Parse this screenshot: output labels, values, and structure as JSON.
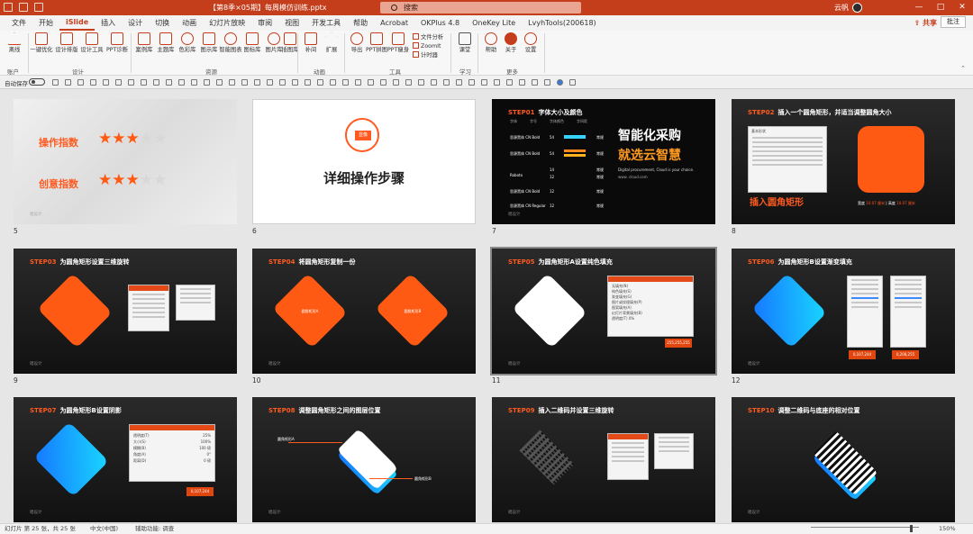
{
  "window": {
    "title": "【第8季×05期】每周模仿训练.pptx",
    "search_placeholder": "搜索",
    "user": "云帆",
    "minimize": "—",
    "restore": "□",
    "close": "✕"
  },
  "tabs": [
    "文件",
    "开始",
    "iSlide",
    "插入",
    "设计",
    "切换",
    "动画",
    "幻灯片放映",
    "审阅",
    "视图",
    "开发工具",
    "帮助",
    "Acrobat",
    "OKPlus 4.8",
    "OneKey Lite",
    "LvyhTools(200618)"
  ],
  "share_label": "共享",
  "comment_label": "批注",
  "ribbon": {
    "buttons": [
      "离线",
      "一键优化",
      "设计排版",
      "设计工具",
      "PPT诊断",
      "案例库",
      "主题库",
      "色彩库",
      "图示库",
      "智能图表",
      "图标库",
      "图片库",
      "插图库",
      "补间",
      "扩展",
      "导出",
      "PPT拼图",
      "PPT瘦身",
      "课堂",
      "帮助",
      "关于",
      "设置"
    ],
    "small": [
      "文件分析",
      "ZoomIt",
      "计时器"
    ],
    "groups": [
      "账户",
      "设计",
      "资源",
      "动画",
      "工具",
      "学习",
      "更多"
    ]
  },
  "qat": {
    "autosave": "自动保存"
  },
  "slides": [
    {
      "num": "5",
      "rating_labels": [
        "操作指数",
        "创意指数"
      ],
      "foot": "唱设计"
    },
    {
      "num": "6",
      "text": "详细操作步骤",
      "logo": "显像"
    },
    {
      "num": "7",
      "step": "STEP01",
      "title": "字体大小及颜色",
      "headline1": "智能化采购",
      "headline2": "就选云智慧",
      "sub1": "Digital procurement, Cloud is your choice.",
      "sub2": "www. cloud.com",
      "col_font": "字体",
      "col_size": "字号",
      "col_color": "字体颜色",
      "col_weight": "字间距",
      "rows": [
        {
          "font": "思源黑体 CN Bold",
          "size": "54",
          "weight": "常规"
        },
        {
          "font": "思源黑体 CN Bold",
          "size": "54",
          "weight": "常规"
        },
        {
          "font": "Roboto",
          "size": "14",
          "weight": "常规"
        },
        {
          "font": "",
          "size": "12",
          "weight": "常规"
        },
        {
          "font": "思源黑体 CN Bold",
          "size": "12",
          "weight": "常规"
        },
        {
          "font": "思源黑体 CN Regular",
          "size": "12",
          "weight": "常规"
        }
      ],
      "foot": "唱设计"
    },
    {
      "num": "8",
      "step": "STEP02",
      "title": "插入一个圆角矩形，并适当调整圆角大小",
      "caption": "插入圆角矩形",
      "w_label": "宽度",
      "w_val": "10.07 厘米",
      "h_label": "高度",
      "h_val": "10.07 厘米",
      "menu": "基本形状",
      "foot": "唱设计"
    },
    {
      "num": "9",
      "step": "STEP03",
      "title": "为圆角矩形设置三维旋转",
      "foot": "唱设计"
    },
    {
      "num": "10",
      "step": "STEP04",
      "title": "将圆角矩形复制一份",
      "label_a": "圆角矩形A",
      "label_b": "圆角矩形B",
      "foot": "唱设计"
    },
    {
      "num": "11",
      "step": "STEP05",
      "title": "为圆角矩形A设置纯色填充",
      "fill": "#FFFFFF",
      "color_code": "255,255,255",
      "transparency_label": "透明度(T)",
      "transparency_val": "0%",
      "options": [
        "无填充(N)",
        "纯色填充(S)",
        "渐变填充(G)",
        "图片或纹理填充(P)",
        "图案填充(A)",
        "幻灯片背景填充(B)"
      ],
      "foot": "唱设计"
    },
    {
      "num": "12",
      "step": "STEP06",
      "title": "为圆角矩形B设置渐变填充",
      "color_code1": "0,107,244",
      "color_code2": "0,208,255",
      "foot": "唱设计"
    },
    {
      "num": "",
      "step": "STEP07",
      "title": "为圆角矩形B设置阴影",
      "color_code": "0,107,244",
      "shadow_rows": [
        "透明度(T)",
        "大小(S)",
        "模糊(B)",
        "角度(A)",
        "距离(D)"
      ],
      "shadow_vals": [
        "25%",
        "100%",
        "100 磅",
        "0°",
        "0 磅"
      ],
      "foot": "唱设计"
    },
    {
      "num": "",
      "step": "STEP08",
      "title": "调整圆角矩形之间的图层位置",
      "label_a": "圆角矩形A",
      "label_b": "圆角矩形B",
      "foot": "唱设计"
    },
    {
      "num": "",
      "step": "STEP09",
      "title": "插入二维码并设置三维旋转",
      "foot": "唱设计"
    },
    {
      "num": "",
      "step": "STEP10",
      "title": "调整二维码与底座的相对位置",
      "foot": "唱设计"
    }
  ],
  "status": {
    "slide_info": "幻灯片 第 25 张，共 25 张",
    "language": "中文(中国)",
    "accessibility": "辅助功能: 调查",
    "zoom": "150%"
  },
  "colors": {
    "accent": "#c43e1c",
    "step_orange": "#ff5a1f"
  }
}
